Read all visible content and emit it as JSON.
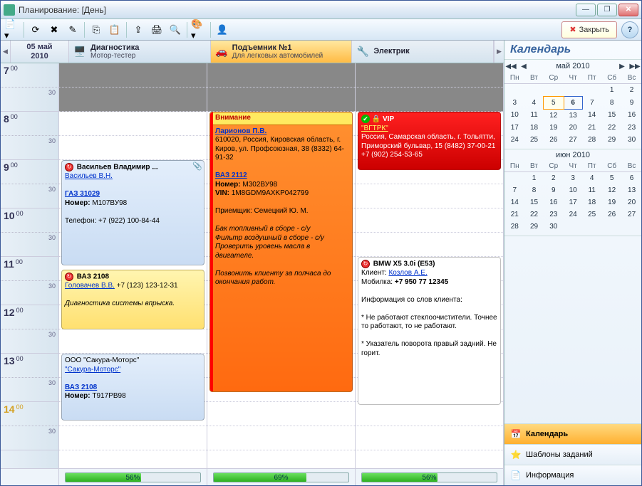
{
  "window": {
    "title": "Планирование: [День]"
  },
  "toolbar": {
    "close_label": "Закрыть"
  },
  "date_header": {
    "line1": "05 май",
    "line2": "2010"
  },
  "resources": [
    {
      "title": "Диагностика",
      "subtitle": "Мотор-тестер",
      "icon": "🖥️",
      "class": "diag"
    },
    {
      "title": "Подъемник №1",
      "subtitle": "Для легковых автомобилей",
      "icon": "🚗",
      "class": "lift"
    },
    {
      "title": "Электрик",
      "subtitle": "",
      "icon": "🔧",
      "class": "elec"
    }
  ],
  "time_slots": [
    "7",
    "8",
    "9",
    "10",
    "11",
    "12",
    "13",
    "14"
  ],
  "half_label": "30",
  "load": [
    "56%",
    "69%",
    "56%"
  ],
  "appointments": {
    "diag1": {
      "title": "Васильев Владимир ...",
      "client": "Васильев В.Н.",
      "car": "ГАЗ 31029",
      "num_label": "Номер:",
      "num": "М107ВУ98",
      "phone_label": "Телефон:",
      "phone": "+7 (922) 100-84-44"
    },
    "diag2": {
      "title": "ВАЗ 2108",
      "client": "Головачев В.В.",
      "phone": "+7 (123) 123-12-31",
      "desc": "Диагностика системы впрыска."
    },
    "diag3": {
      "company": "ООО \"Сакура-Моторс\"",
      "client": "\"Сакура-Моторс\"",
      "car": "ВАЗ 2108",
      "num_label": "Номер:",
      "num": "Т917РВ98"
    },
    "lift1": {
      "attention": "Внимание",
      "client": "Ларионов П.В.",
      "addr": "610020, Россия, Кировская область, г. Киров, ул. Профсоюзная, 38 (8332) 64-91-32",
      "car": "ВАЗ 2112",
      "num_label": "Номер:",
      "num": "М302ВУ98",
      "vin_label": "VIN:",
      "vin": "1M8GDM9AXKP042799",
      "recv": "Приемщик: Семецкий Ю. М.",
      "work1": "Бак топливный в сборе - с/у",
      "work2": "Фильтр воздушный в сборе - с/у",
      "work3": "Проверить уровень масла в двигателе.",
      "note": "Позвонить клиенту за полчаса до окончания работ."
    },
    "elec1": {
      "vip": "VIP",
      "client": "\"ВГТРК\"",
      "addr": "Россия, Самарская область, г. Тольятти, Приморский бульвар, 15 (8482) 37-00-21 +7 (902) 254-53-65"
    },
    "elec2": {
      "car": "BMW X5 3.0i (E53)",
      "client_label": "Клиент:",
      "client": "Козлов А.Е.",
      "phone_label": "Мобилка:",
      "phone": "+7 950 77 12345",
      "info_hdr": "Информация со слов клиента:",
      "p1": "* Не работают стеклоочистители. Точнее то работают, то не работают.",
      "p2": "* Указатель поворота правый задний. Не горит."
    }
  },
  "sidebar": {
    "title": "Календарь",
    "months": {
      "may": "май 2010",
      "jun": "июн 2010"
    },
    "dow": [
      "Пн",
      "Вт",
      "Ср",
      "Чт",
      "Пт",
      "Сб",
      "Вс"
    ],
    "items": {
      "calendar": "Календарь",
      "templates": "Шаблоны заданий",
      "info": "Информация"
    }
  },
  "cal_may": [
    [
      "",
      "",
      "",
      "",
      "",
      "1",
      "2"
    ],
    [
      "3",
      "4",
      "5",
      "6",
      "7",
      "8",
      "9"
    ],
    [
      "10",
      "11",
      "12",
      "13",
      "14",
      "15",
      "16"
    ],
    [
      "17",
      "18",
      "19",
      "20",
      "21",
      "22",
      "23"
    ],
    [
      "24",
      "25",
      "26",
      "27",
      "28",
      "29",
      "30"
    ]
  ],
  "cal_jun": [
    [
      "",
      "1",
      "2",
      "3",
      "4",
      "5",
      "6"
    ],
    [
      "7",
      "8",
      "9",
      "10",
      "11",
      "12",
      "13"
    ],
    [
      "14",
      "15",
      "16",
      "17",
      "18",
      "19",
      "20"
    ],
    [
      "21",
      "22",
      "23",
      "24",
      "25",
      "26",
      "27"
    ],
    [
      "28",
      "29",
      "30",
      "",
      "",
      "",
      ""
    ]
  ]
}
